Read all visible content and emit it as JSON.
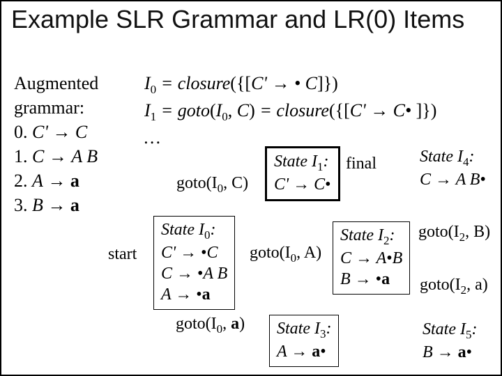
{
  "title": "Example SLR Grammar and LR(0) Items",
  "grammar": {
    "heading": "Augmented grammar:",
    "rules": [
      "0. C' → C",
      "1. C → A B",
      "2. A → a",
      "3. B → a"
    ]
  },
  "closure": {
    "line1_pre": "I",
    "line1_sub": "0",
    "line1_post": " = closure({[C' → • C]})",
    "line2_pre": "I",
    "line2_sub": "1",
    "line2_mid": " = goto(I",
    "line2_sub2": "0",
    "line2_post": ", C) = closure({[C' → C• ]})",
    "line3": "…"
  },
  "states": {
    "i0": {
      "title_pre": "State I",
      "title_sub": "0",
      "title_post": ":",
      "l1": "C' → •C",
      "l2": "C → •A B",
      "l3": "A → •a"
    },
    "i1": {
      "title_pre": "State I",
      "title_sub": "1",
      "title_post": ":",
      "l1": "C' → C•"
    },
    "i2": {
      "title_pre": "State I",
      "title_sub": "2",
      "title_post": ":",
      "l1": "C → A•B",
      "l2": "B → •a"
    },
    "i3": {
      "title_pre": "State I",
      "title_sub": "3",
      "title_post": ":",
      "l1": "A → a•"
    },
    "i4": {
      "title_pre": "State I",
      "title_sub": "4",
      "title_post": ":",
      "l1": "C → A B•"
    },
    "i5": {
      "title_pre": "State I",
      "title_sub": "5",
      "title_post": ":",
      "l1": "B → a•"
    }
  },
  "labels": {
    "start": "start",
    "final": "final",
    "goto_I0_C_pre": "goto(I",
    "goto_I0_C_sub": "0",
    "goto_I0_C_post": ", C)",
    "goto_I0_A_pre": "goto(I",
    "goto_I0_A_sub": "0",
    "goto_I0_A_post": ", A)",
    "goto_I0_a_pre": "goto(I",
    "goto_I0_a_sub": "0",
    "goto_I0_a_post": ", a)",
    "goto_I2_B_pre": "goto(I",
    "goto_I2_B_sub": "2",
    "goto_I2_B_post": ", B)",
    "goto_I2_a_pre": "goto(I",
    "goto_I2_a_sub": "2",
    "goto_I2_a_post": ", a)"
  },
  "chart_data": {
    "type": "table",
    "description": "LR(0) item set automaton for augmented grammar C'→C, C→AB, A→a, B→a",
    "states": [
      {
        "id": "I0",
        "items": [
          "C'→•C",
          "C→•AB",
          "A→•a"
        ],
        "start": true
      },
      {
        "id": "I1",
        "items": [
          "C'→C•"
        ],
        "final": true
      },
      {
        "id": "I2",
        "items": [
          "C→A•B",
          "B→•a"
        ]
      },
      {
        "id": "I3",
        "items": [
          "A→a•"
        ]
      },
      {
        "id": "I4",
        "items": [
          "C→AB•"
        ]
      },
      {
        "id": "I5",
        "items": [
          "B→a•"
        ]
      }
    ],
    "transitions": [
      {
        "from": "I0",
        "on": "C",
        "to": "I1"
      },
      {
        "from": "I0",
        "on": "A",
        "to": "I2"
      },
      {
        "from": "I0",
        "on": "a",
        "to": "I3"
      },
      {
        "from": "I2",
        "on": "B",
        "to": "I4"
      },
      {
        "from": "I2",
        "on": "a",
        "to": "I5"
      }
    ]
  }
}
